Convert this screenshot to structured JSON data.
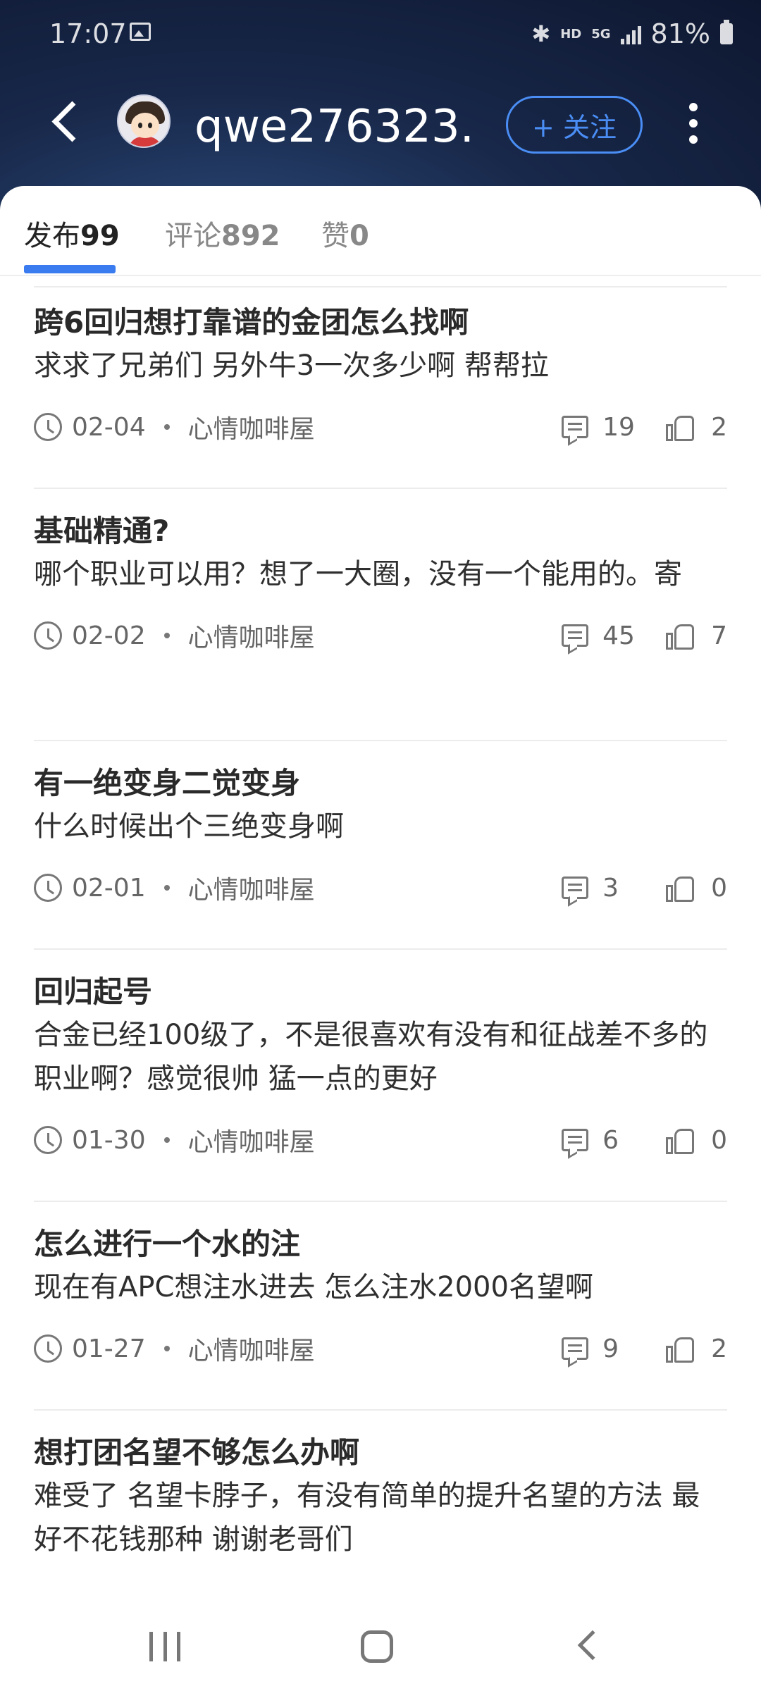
{
  "status_bar": {
    "time": "17:07",
    "network": "HD",
    "net_type": "5G",
    "battery": "81%"
  },
  "header": {
    "username": "qwe276323...",
    "follow_label": "+ 关注"
  },
  "tabs": [
    {
      "label": "发布",
      "count": "99",
      "active": true
    },
    {
      "label": "评论",
      "count": "892",
      "active": false
    },
    {
      "label": "赞",
      "count": "0",
      "active": false
    }
  ],
  "posts": [
    {
      "title": "跨6回归想打靠谱的金团怎么找啊",
      "body": "求求了兄弟们 另外牛3一次多少啊 帮帮拉",
      "date": "02-04",
      "board": "心情咖啡屋",
      "comments": "19",
      "likes": "2"
    },
    {
      "title": "基础精通?",
      "body": "哪个职业可以用？想了一大圈，没有一个能用的。寄",
      "date": "02-02",
      "board": "心情咖啡屋",
      "comments": "45",
      "likes": "7"
    },
    {
      "title": "有一绝变身二觉变身",
      "body": "什么时候出个三绝变身啊",
      "date": "02-01",
      "board": "心情咖啡屋",
      "comments": "3",
      "likes": "0"
    },
    {
      "title": "回归起号",
      "body": "合金已经100级了，不是很喜欢有没有和征战差不多的职业啊？感觉很帅 猛一点的更好",
      "date": "01-30",
      "board": "心情咖啡屋",
      "comments": "6",
      "likes": "0"
    },
    {
      "title": "怎么进行一个水的注",
      "body": "现在有APC想注水进去  怎么注水2000名望啊",
      "date": "01-27",
      "board": "心情咖啡屋",
      "comments": "9",
      "likes": "2"
    },
    {
      "title": "想打团名望不够怎么办啊",
      "body": "难受了  名望卡脖子，有没有简单的提升名望的方法 最好不花钱那种 谢谢老哥们",
      "date": "",
      "board": "",
      "comments": "",
      "likes": ""
    }
  ],
  "colors": {
    "accent": "#3a7bf0",
    "follow": "#4a8ef5",
    "header_bg": "#18284a"
  }
}
